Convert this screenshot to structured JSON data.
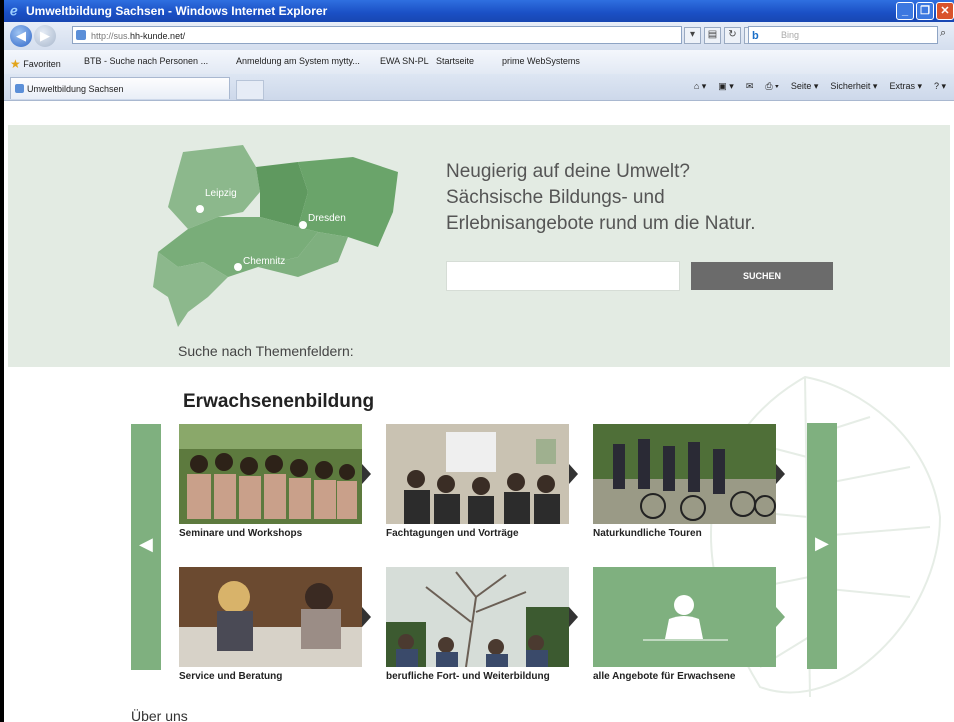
{
  "window": {
    "title": "Umweltbildung Sachsen - Windows Internet Explorer"
  },
  "addressbar": {
    "url_prefix": "http://sus.",
    "url_host": "hh-kunde.net/",
    "search_placeholder": "Bing"
  },
  "favorites": {
    "label": "Favoriten",
    "items": [
      "BTB - Suche nach Personen ...",
      "Anmeldung am System mytty...",
      "EWA SN-PL",
      "Startseite",
      "prime WebSystems"
    ]
  },
  "tab": {
    "title": "Umweltbildung Sachsen"
  },
  "commandbar": {
    "items": [
      "Seite ▾",
      "Sicherheit ▾",
      "Extras ▾"
    ]
  },
  "hero": {
    "headline_lines": [
      "Neugierig auf deine Umwelt?",
      "Sächsische Bildungs- und",
      "Erlebnisangebote rund um die Natur."
    ],
    "search_button": "SUCHEN",
    "theme_label": "Suche nach Themenfeldern:",
    "cities": [
      "Leipzig",
      "Dresden",
      "Chemnitz"
    ]
  },
  "section": {
    "title": "Erwachsenenbildung",
    "tiles": [
      "Seminare und Workshops",
      "Fachtagungen und Vorträge",
      "Naturkundliche Touren",
      "Service und Beratung",
      "berufliche Fort- und Weiterbildung",
      "alle Angebote für Erwachsene"
    ]
  },
  "footer": {
    "about": "Über uns"
  },
  "colors": {
    "accent_green": "#7fb07f",
    "hero_bg": "#e3ebe3",
    "button_gray": "#6b6b6b"
  }
}
